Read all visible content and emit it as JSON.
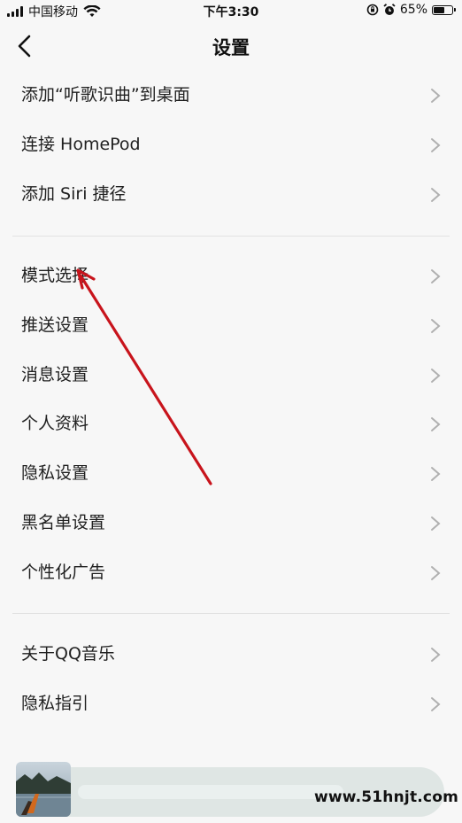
{
  "status_bar": {
    "carrier": "中国移动",
    "time": "下午3:30",
    "battery_percent": "65%",
    "battery_level": 0.65
  },
  "nav": {
    "title": "设置"
  },
  "groups": [
    {
      "items": [
        {
          "label": "添加“听歌识曲”到桌面"
        },
        {
          "label": "连接 HomePod"
        },
        {
          "label": "添加 Siri 捷径"
        }
      ]
    },
    {
      "items": [
        {
          "label": "模式选择"
        },
        {
          "label": "推送设置"
        },
        {
          "label": "消息设置"
        },
        {
          "label": "个人资料"
        },
        {
          "label": "隐私设置"
        },
        {
          "label": "黑名单设置"
        },
        {
          "label": "个性化广告"
        }
      ]
    },
    {
      "items": [
        {
          "label": "关于QQ音乐"
        },
        {
          "label": "隐私指引"
        }
      ]
    }
  ],
  "watermark": "www.51hnjt.com",
  "annotation_color": "#c8141c"
}
